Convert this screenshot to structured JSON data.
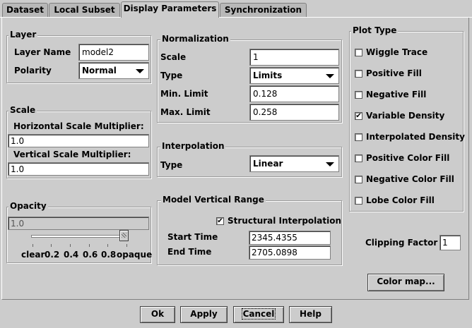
{
  "tabs": [
    "Dataset",
    "Local Subset",
    "Display Parameters",
    "Synchronization"
  ],
  "layer": {
    "title": "Layer",
    "name_label": "Layer Name",
    "name_value": "model2",
    "polarity_label": "Polarity",
    "polarity_value": "Normal"
  },
  "scale": {
    "title": "Scale",
    "h_label": "Horizontal Scale Multiplier:",
    "h_value": "1.0",
    "v_label": "Vertical Scale Multiplier:",
    "v_value": "1.0"
  },
  "opacity": {
    "title": "Opacity",
    "value": "1.0",
    "slider_fraction": 1.0,
    "labels": [
      "clear",
      "0.2",
      "0.4",
      "0.6",
      "0.8",
      "opaque"
    ]
  },
  "normalization": {
    "title": "Normalization",
    "scale_label": "Scale",
    "scale_value": "1",
    "type_label": "Type",
    "type_value": "Limits",
    "min_label": "Min. Limit",
    "min_value": "0.128",
    "max_label": "Max. Limit",
    "max_value": "0.258"
  },
  "interpolation": {
    "title": "Interpolation",
    "type_label": "Type",
    "type_value": "Linear"
  },
  "model_range": {
    "title": "Model Vertical Range",
    "structural_label": "Structural Interpolation",
    "structural_checked": true,
    "start_label": "Start Time",
    "start_value": "2345.4355",
    "end_label": "End Time",
    "end_value": "2705.0898"
  },
  "plot_type": {
    "title": "Plot Type",
    "options": [
      {
        "label": "Wiggle Trace",
        "checked": false
      },
      {
        "label": "Positive Fill",
        "checked": false
      },
      {
        "label": "Negative Fill",
        "checked": false
      },
      {
        "label": "Variable Density",
        "checked": true
      },
      {
        "label": "Interpolated Density",
        "checked": false
      },
      {
        "label": "Positive Color Fill",
        "checked": false
      },
      {
        "label": "Negative Color Fill",
        "checked": false
      },
      {
        "label": "Lobe Color Fill",
        "checked": false
      }
    ]
  },
  "clipping": {
    "label": "Clipping Factor",
    "value": "1"
  },
  "color_map_button": "Color map...",
  "buttons": {
    "ok": "Ok",
    "apply": "Apply",
    "cancel": "Cancel",
    "help": "Help"
  },
  "check_glyph": "✔"
}
